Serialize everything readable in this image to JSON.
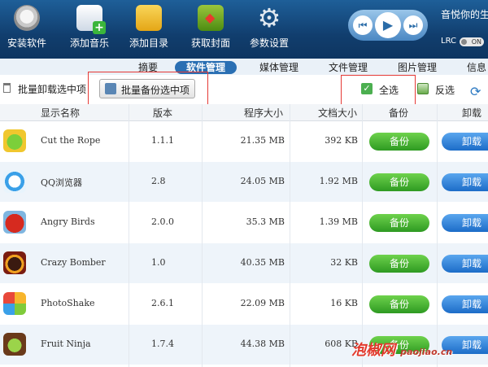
{
  "toolbar": {
    "install": "安装软件",
    "add_music": "添加音乐",
    "add_dir": "添加目录",
    "get_cover": "获取封面",
    "settings": "参数设置"
  },
  "player": {
    "now_playing": "音悦你的生",
    "lrc_label": "LRC",
    "lrc_state": "ON"
  },
  "tabs": [
    "摘要",
    "软件管理",
    "媒体管理",
    "文件管理",
    "图片管理",
    "信息"
  ],
  "actions": {
    "batch_uninstall": "批量卸载选中项",
    "batch_backup": "批量备份选中项",
    "select_all": "全选",
    "invert": "反选"
  },
  "table": {
    "headers": {
      "name": "显示名称",
      "version": "版本",
      "app_size": "程序大小",
      "doc_size": "文档大小",
      "backup": "备份",
      "uninstall": "卸载"
    },
    "backup_label": "备份",
    "uninstall_label": "卸载",
    "rows": [
      {
        "name": "Cut the Rope",
        "version": "1.1.1",
        "app_size": "21.35 MB",
        "doc_size": "392 KB",
        "icon": "cut-the-rope-icon"
      },
      {
        "name": "QQ浏览器",
        "version": "2.8",
        "app_size": "24.05 MB",
        "doc_size": "1.92 MB",
        "icon": "qq-browser-icon"
      },
      {
        "name": "Angry Birds",
        "version": "2.0.0",
        "app_size": "35.3 MB",
        "doc_size": "1.39 MB",
        "icon": "angry-birds-icon"
      },
      {
        "name": "Crazy Bomber",
        "version": "1.0",
        "app_size": "40.35 MB",
        "doc_size": "32 KB",
        "icon": "crazy-bomber-icon"
      },
      {
        "name": "PhotoShake",
        "version": "2.6.1",
        "app_size": "22.09 MB",
        "doc_size": "16 KB",
        "icon": "photoshake-icon"
      },
      {
        "name": "Fruit Ninja",
        "version": "1.7.4",
        "app_size": "44.38 MB",
        "doc_size": "608 KB",
        "icon": "fruit-ninja-icon"
      }
    ]
  },
  "watermark": {
    "main": "泡椒网",
    "url": "paojiao.cn"
  },
  "colors": {
    "header": "#134a80",
    "accent_green": "#3aa82a",
    "accent_blue": "#2a7ad2",
    "highlight_box": "#e53935"
  }
}
